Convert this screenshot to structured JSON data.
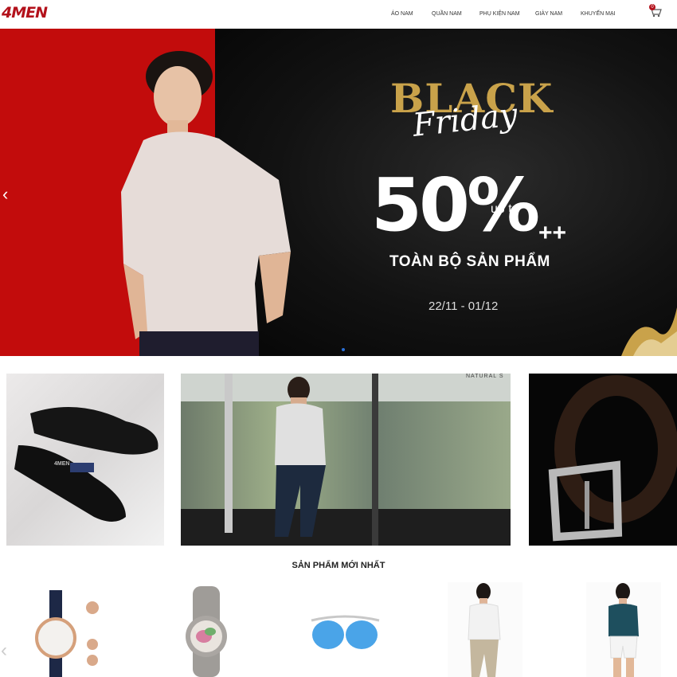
{
  "header": {
    "logo": "4MEN",
    "nav": [
      "ÁO NAM",
      "QUẦN NAM",
      "PHỤ KIỆN NAM",
      "GIÀY NAM",
      "KHUYẾN MẠI"
    ],
    "cart_count": "0"
  },
  "hero": {
    "black": "BLACK",
    "friday": "Friday",
    "percent": "50%",
    "up_to": "up to",
    "plus": "++",
    "all_products": "TOÀN BỘ SẢN PHẨM",
    "dates": "22/11 - 01/12",
    "prev_arrow": "‹",
    "colors": {
      "red": "#c20c0c",
      "gold": "#c9a24a"
    }
  },
  "banners": {
    "shoe_brand": "4MEN",
    "store_sign": "NATURAL S"
  },
  "products_section": {
    "title": "SẢN PHẨM MỚI NHẤT",
    "prev_arrow": "‹"
  },
  "icons": [
    "cart-icon",
    "chevron-left-icon"
  ]
}
